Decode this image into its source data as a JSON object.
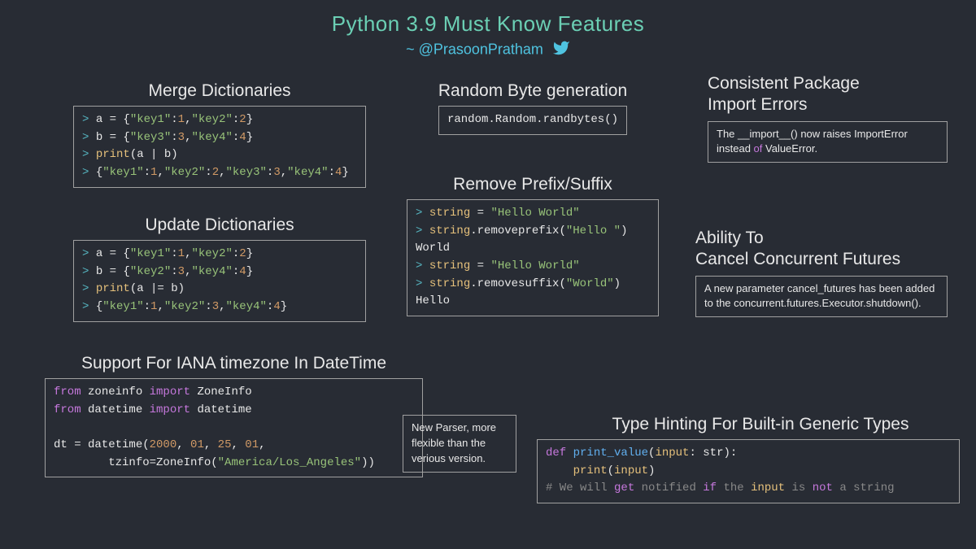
{
  "title": "Python 3.9 Must Know Features",
  "subtitle_prefix": "~ ",
  "subtitle_handle": "@PrasoonPratham",
  "sections": {
    "merge": {
      "title": "Merge Dictionaries",
      "lines": {
        "l1_gt": "> ",
        "l1_a": "a = {",
        "l1_k1": "\"key1\"",
        "l1_c1": ":",
        "l1_v1": "1",
        "l1_c2": ",",
        "l1_k2": "\"key2\"",
        "l1_c3": ":",
        "l1_v2": "2",
        "l1_end": "}",
        "l2_gt": "> ",
        "l2_a": "b = {",
        "l2_k1": "\"key3\"",
        "l2_c1": ":",
        "l2_v1": "3",
        "l2_c2": ",",
        "l2_k2": "\"key4\"",
        "l2_c3": ":",
        "l2_v2": "4",
        "l2_end": "}",
        "l3_gt": "> ",
        "l3_a": "print",
        "l3_b": "(a | b)",
        "l4_gt": "> ",
        "l4_a": "{",
        "l4_k1": "\"key1\"",
        "l4_c1": ":",
        "l4_v1": "1",
        "l4_c2": ",",
        "l4_k2": "\"key2\"",
        "l4_c3": ":",
        "l4_v2": "2",
        "l4_c4": ",",
        "l4_k3": "\"key3\"",
        "l4_c5": ":",
        "l4_v3": "3",
        "l4_c6": ",",
        "l4_k4": "\"key4\"",
        "l4_c7": ":",
        "l4_v4": "4",
        "l4_end": "}"
      }
    },
    "update": {
      "title": "Update Dictionaries",
      "lines": {
        "l1_gt": "> ",
        "l1_a": "a = {",
        "l1_k1": "\"key1\"",
        "l1_c1": ":",
        "l1_v1": "1",
        "l1_c2": ",",
        "l1_k2": "\"key2\"",
        "l1_c3": ":",
        "l1_v2": "2",
        "l1_end": "}",
        "l2_gt": "> ",
        "l2_a": "b = {",
        "l2_k1": "\"key2\"",
        "l2_c1": ":",
        "l2_v1": "3",
        "l2_c2": ",",
        "l2_k2": "\"key4\"",
        "l2_c3": ":",
        "l2_v2": "4",
        "l2_end": "}",
        "l3_gt": "> ",
        "l3_a": "print",
        "l3_b": "(a |= b)",
        "l4_gt": "> ",
        "l4_a": "{",
        "l4_k1": "\"key1\"",
        "l4_c1": ":",
        "l4_v1": "1",
        "l4_c2": ",",
        "l4_k2": "\"key2\"",
        "l4_c3": ":",
        "l4_v2": "3",
        "l4_c4": ",",
        "l4_k3": "\"key4\"",
        "l4_c5": ":",
        "l4_v3": "4",
        "l4_end": "}"
      }
    },
    "iana": {
      "title": "Support For IANA timezone In DateTime",
      "lines": {
        "l1_a": "from",
        "l1_b": " zoneinfo ",
        "l1_c": "import",
        "l1_d": " ZoneInfo",
        "l2_a": "from",
        "l2_b": " datetime ",
        "l2_c": "import",
        "l2_d": " datetime",
        "blank": "",
        "l3_a": "dt = datetime(",
        "l3_n1": "2000",
        "l3_c1": ", ",
        "l3_n2": "01",
        "l3_c2": ", ",
        "l3_n3": "25",
        "l3_c3": ", ",
        "l3_n4": "01",
        "l3_c4": ",",
        "l4_pad": "        ",
        "l4_a": "tzinfo=ZoneInfo(",
        "l4_s": "\"America/Los_Angeles\"",
        "l4_end": "))"
      }
    },
    "random": {
      "title": "Random Byte generation",
      "code": "random.Random.randbytes()"
    },
    "remove": {
      "title": "Remove Prefix/Suffix",
      "lines": {
        "l1_gt": "> ",
        "l1_a": "string",
        "l1_b": " = ",
        "l1_s": "\"Hello World\"",
        "l2_gt": "> ",
        "l2_a": "string",
        "l2_b": ".removeprefix(",
        "l2_s": "\"Hello \"",
        "l2_end": ")",
        "l3": "World",
        "l4_gt": "> ",
        "l4_a": "string",
        "l4_b": " = ",
        "l4_s": "\"Hello World\"",
        "l5_gt": "> ",
        "l5_a": "string",
        "l5_b": ".removesuffix(",
        "l5_s": "\"World\"",
        "l5_end": ")",
        "l6": "Hello"
      }
    },
    "parser": {
      "text": "New Parser, more flexible than the verious version."
    },
    "consist": {
      "title_l1": "Consistent Package",
      "title_l2": "Import Errors",
      "text_a": "The __import__() now raises ImportError instead ",
      "text_of": "of",
      "text_b": " ValueError."
    },
    "cancel": {
      "title_l1": "Ability To",
      "title_l2": "Cancel Concurrent Futures",
      "text": "A new parameter cancel_futures has been added to the concurrent.futures.Executor.shutdown()."
    },
    "typehint": {
      "title": "Type Hinting For Built-in Generic Types",
      "lines": {
        "l1_a": "def",
        "l1_b": " print_value",
        "l1_c": "(",
        "l1_d": "input",
        "l1_e": ": str):",
        "l2_pad": "    ",
        "l2_a": "print",
        "l2_b": "(",
        "l2_c": "input",
        "l2_d": ")",
        "l3_a": "# We will ",
        "l3_get": "get",
        "l3_b": " notified ",
        "l3_if": "if",
        "l3_c": " the ",
        "l3_in": "input",
        "l3_d": " is ",
        "l3_not": "not",
        "l3_e": " a string"
      }
    }
  }
}
